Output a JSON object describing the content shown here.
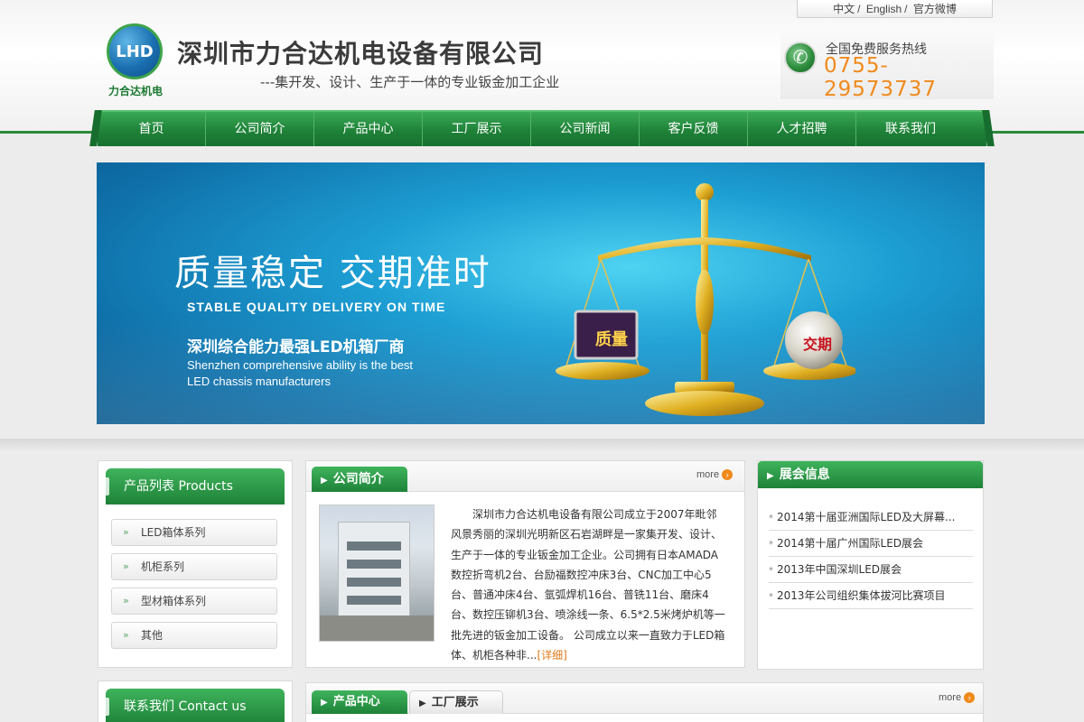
{
  "header": {
    "lang_links": [
      "中文",
      "English",
      "官方微博"
    ],
    "logo_mark": "LHD",
    "logo_text": "力合达机电",
    "company_name": "深圳市力合达机电设备有限公司",
    "slogan": "---集开发、设计、生产于一体的专业钣金加工企业",
    "hotline_label": "全国免费服务热线",
    "hotline_number": "0755-29573737"
  },
  "nav": [
    "首页",
    "公司简介",
    "产品中心",
    "工厂展示",
    "公司新闻",
    "客户反馈",
    "人才招聘",
    "联系我们"
  ],
  "banner": {
    "title": "质量稳定 交期准时",
    "subtitle_en": "STABLE QUALITY DELIVERY ON TIME",
    "tagline_cn": "深圳综合能力最强LED机箱厂商",
    "tagline_en_1": "Shenzhen comprehensive ability is the best",
    "tagline_en_2": "LED chassis manufacturers",
    "left_pan_label": "质量",
    "right_pan_label": "交期"
  },
  "products": {
    "title": "产品列表 Products",
    "items": [
      "LED箱体系列",
      "机柜系列",
      "型材箱体系列",
      "其他"
    ]
  },
  "about": {
    "tab": "公司简介",
    "more": "more",
    "text": "深圳市力合达机电设备有限公司成立于2007年毗邻风景秀丽的深圳光明新区石岩湖畔是一家集开发、设计、生产于一体的专业钣金加工企业。公司拥有日本AMADA数控折弯机2台、台励福数控冲床3台、CNC加工中心5台、普通冲床4台、氩弧焊机16台、普铣11台、磨床4台、数控压铆机3台、喷涂线一条、6.5*2.5米烤炉机等一批先进的钣金加工设备。 公司成立以来一直致力于LED箱体、机柜各种非...",
    "detail": "[详细]"
  },
  "exhibitions": {
    "title": "展会信息",
    "items": [
      "2014第十届亚洲国际LED及大屏幕...",
      "2014第十届广州国际LED展会",
      "2013年中国深圳LED展会",
      "2013年公司组织集体拔河比赛项目"
    ]
  },
  "contact": {
    "title": "联系我们 Contact us"
  },
  "bottom_tabs": {
    "tab1": "产品中心",
    "tab2": "工厂展示",
    "more": "more"
  }
}
